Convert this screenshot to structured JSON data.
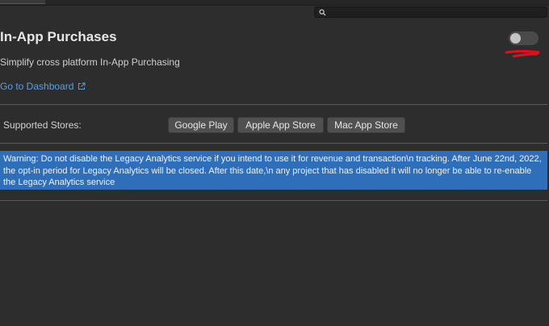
{
  "search": {
    "placeholder": ""
  },
  "header": {
    "title": "In-App Purchases",
    "subtitle": "Simplify cross platform In-App Purchasing",
    "dashboard_link": "Go to Dashboard",
    "service_enabled": false
  },
  "stores": {
    "label": "Supported Stores:",
    "buttons": [
      "Google Play",
      "Apple App Store",
      "Mac App Store"
    ]
  },
  "warning": {
    "text": "Warning: Do not disable the Legacy Analytics service if you intend to use it for revenue and transaction\\n tracking. After June 22nd, 2022, the opt-in period for Legacy Analytics will be closed. After this date,\\n any project that has disabled it will no longer be able to re-enable the Legacy Analytics service"
  },
  "colors": {
    "background": "#2d2d2d",
    "link": "#5a9ee6",
    "warning_bg": "#2f6fba",
    "annotation": "#e0101a"
  }
}
